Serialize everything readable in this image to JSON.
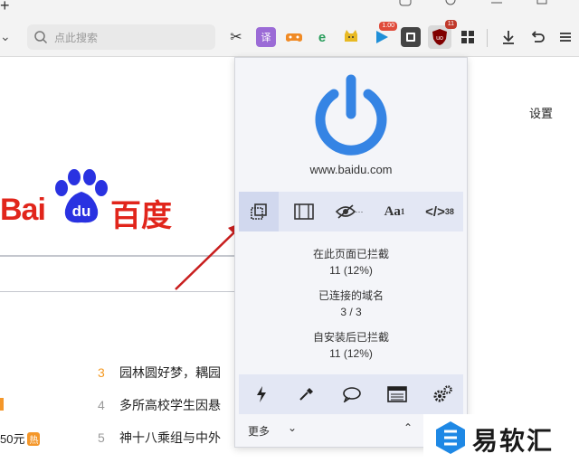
{
  "tabs": {
    "new_tab_symbol": "+"
  },
  "toolbar": {
    "search_placeholder": "点此搜索",
    "extensions": [
      {
        "name": "scissors-icon",
        "label": "✂"
      },
      {
        "name": "translate-icon",
        "label": "译"
      },
      {
        "name": "gamepad-icon",
        "label": ""
      },
      {
        "name": "edge-icon",
        "label": "e"
      },
      {
        "name": "cat-icon",
        "label": ""
      },
      {
        "name": "play-icon",
        "label": "▶",
        "badge": "1.00"
      },
      {
        "name": "book-icon",
        "label": ""
      },
      {
        "name": "ublock-icon",
        "label": "uo",
        "badge": "11"
      },
      {
        "name": "apps-grid-icon",
        "label": ""
      },
      {
        "name": "download-icon",
        "label": ""
      },
      {
        "name": "undo-icon",
        "label": ""
      },
      {
        "name": "menu-icon",
        "label": ""
      }
    ]
  },
  "page": {
    "settings_label": "设置",
    "logo_text": "Bai",
    "logo_du": "du",
    "logo_cn": "百度",
    "hot_list": [
      {
        "num": "3",
        "text": "园林圆好梦，耦园"
      },
      {
        "num": "4",
        "text": "多所高校学生因悬"
      },
      {
        "num": "5",
        "text": "神十八乘组与中外"
      }
    ],
    "left_price": "50元",
    "hot_tag": "热"
  },
  "popup": {
    "hostname": "www.baidu.com",
    "tools": [
      {
        "name": "element-picker-icon",
        "label": "",
        "sup": ""
      },
      {
        "name": "media-icon",
        "label": "",
        "sup": ""
      },
      {
        "name": "cosmetic-filter-icon",
        "label": "",
        "sup": "···"
      },
      {
        "name": "font-icon",
        "label": "Aa",
        "sup": "1"
      },
      {
        "name": "script-icon",
        "label": "</>",
        "sup": "38"
      }
    ],
    "stats": [
      {
        "label": "在此页面已拦截",
        "value": "11 (12%)"
      },
      {
        "label": "已连接的域名",
        "value": "3 / 3"
      },
      {
        "label": "自安装后已拦截",
        "value": "11 (12%)"
      }
    ],
    "bottom_tools": [
      "lightning-icon",
      "eyedropper-icon",
      "comment-icon",
      "logger-icon",
      "settings-gears-icon"
    ],
    "more_label": "更多",
    "colors": {
      "power": "#3584e4",
      "panel": "#f4f5f9",
      "toolbar_row": "#e3e7f4"
    }
  },
  "watermark": {
    "text": "易软汇"
  }
}
